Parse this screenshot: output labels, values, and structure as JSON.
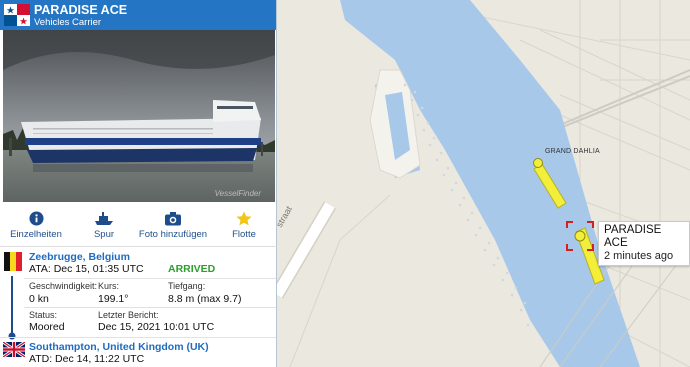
{
  "vessel": {
    "name": "PARADISE ACE",
    "type": "Vehicles Carrier",
    "photo_watermark": "VesselFinder"
  },
  "actions": [
    {
      "label": "Einzelheiten",
      "icon": "info-icon"
    },
    {
      "label": "Spur",
      "icon": "ship-icon"
    },
    {
      "label": "Foto hinzufügen",
      "icon": "camera-icon"
    },
    {
      "label": "Flotte",
      "icon": "star-icon"
    }
  ],
  "arrival": {
    "port": "Zeebrugge, Belgium",
    "ata": "ATA: Dec 15, 01:35 UTC",
    "status_badge": "ARRIVED"
  },
  "details": {
    "speed_label": "Geschwindigkeit:",
    "speed_value": "0 kn",
    "course_label": "Kurs:",
    "course_value": "199.1°",
    "draught_label": "Tiefgang:",
    "draught_value": "8.8 m (max 9.7)",
    "status_label": "Status:",
    "status_value": "Moored",
    "report_label": "Letzter Bericht:",
    "report_value": "Dec 15, 2021 10:01 UTC"
  },
  "departure": {
    "port": "Southampton, United Kingdom (UK)",
    "atd": "ATD: Dec 14, 11:22 UTC"
  },
  "map": {
    "selected_vessel": "PARADISE ACE",
    "selected_age": "2 minutes ago",
    "other_vessel": "GRAND DAHLIA",
    "road_label": "straat"
  },
  "colors": {
    "header": "#2476c4",
    "water": "#a8c8ea",
    "vessel_marker": "#f2ee3a",
    "arrived": "#2e9e2e",
    "selection": "#d42020"
  }
}
